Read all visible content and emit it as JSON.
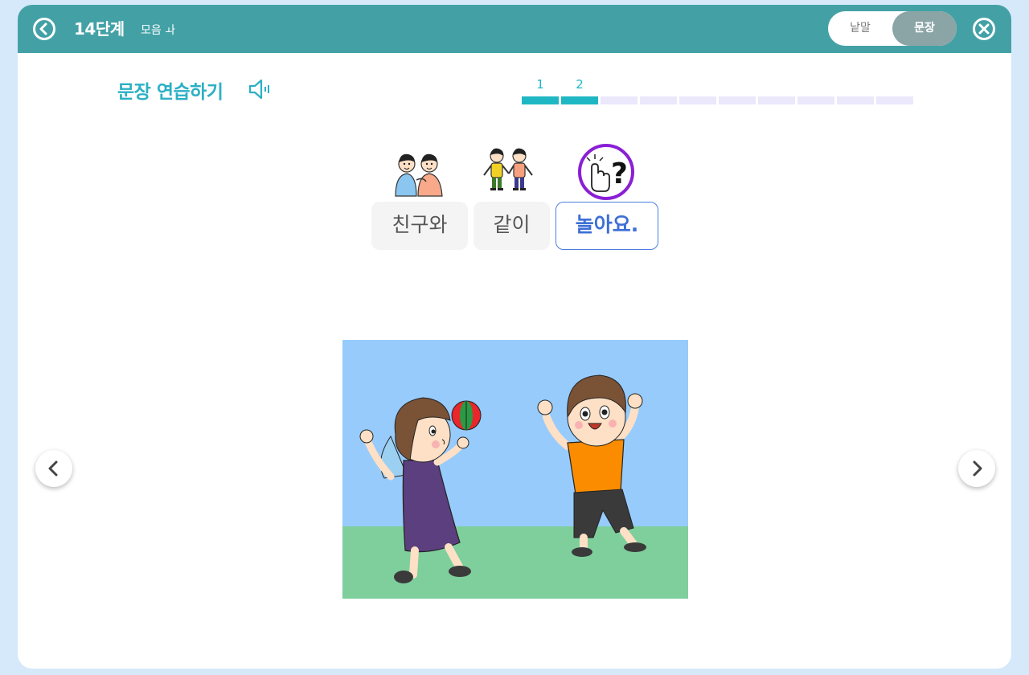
{
  "header": {
    "level_title": "14단계",
    "level_subtitle": "모음 ㅘ",
    "toggle": {
      "word_label": "낱말",
      "sentence_label": "문장",
      "selected": "문장"
    }
  },
  "practice": {
    "title": "문장 연습하기",
    "progress": {
      "current": 2,
      "total": 10,
      "labels": [
        "1",
        "2"
      ]
    }
  },
  "sentence": {
    "words": [
      {
        "text": "친구와",
        "icon": "friends-icon"
      },
      {
        "text": "같이",
        "icon": "together-icon"
      },
      {
        "text": "놀아요.",
        "icon": "tap-question-icon",
        "active": true
      }
    ]
  },
  "scene": {
    "description_icon": "children-playing-ball-illustration"
  },
  "colors": {
    "header": "#43a1a6",
    "accent": "#1fb7c4",
    "active_chip": "#4b7ee0",
    "background": "#d6e9fb"
  }
}
